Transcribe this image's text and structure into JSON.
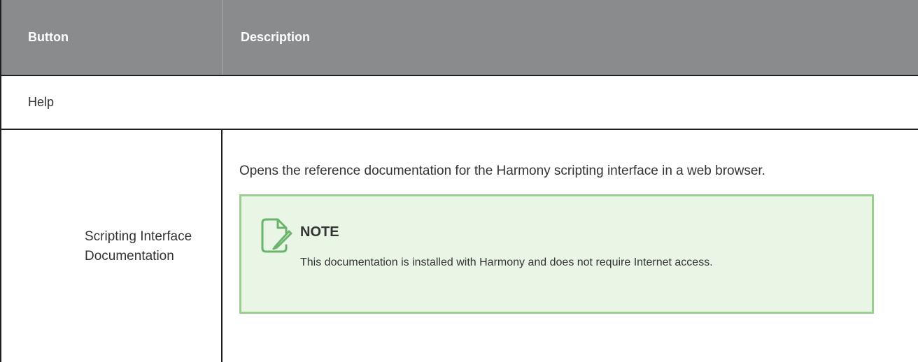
{
  "table": {
    "header": {
      "col1": "Button",
      "col2": "Description"
    },
    "section": "Help",
    "rows": [
      {
        "button_name": "Scripting Interface Documentation",
        "description": "Opens the reference documentation for the Harmony scripting interface in a web browser.",
        "note": {
          "icon": "note-pencil-icon",
          "title": "NOTE",
          "text": "This documentation is installed with Harmony and does not require Internet access."
        }
      }
    ]
  },
  "colors": {
    "header_bg": "#8a8b8d",
    "note_bg": "#e9f5e5",
    "note_border": "#9bcf90",
    "note_icon": "#6bb46b"
  }
}
